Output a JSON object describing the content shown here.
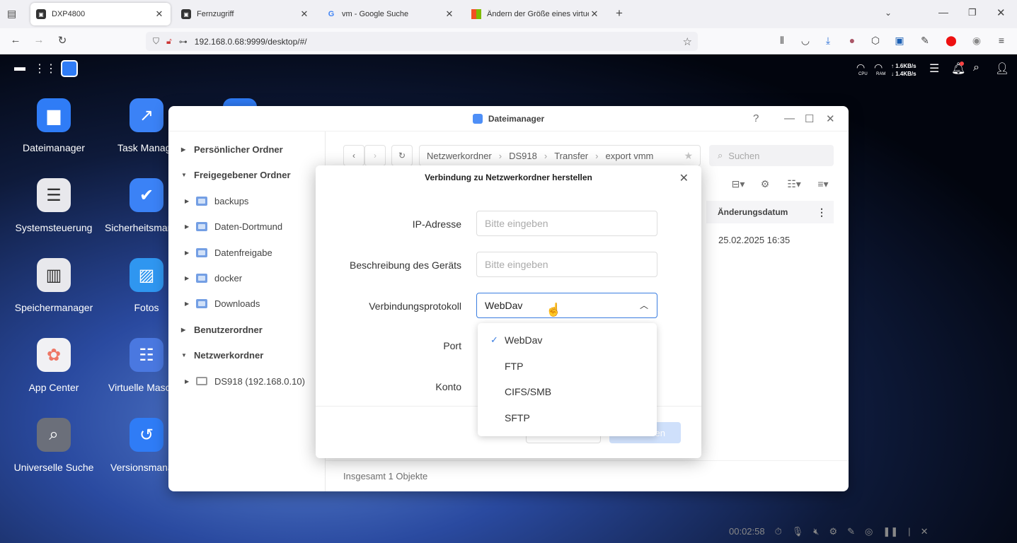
{
  "browser": {
    "tabs": [
      {
        "title": "DXP4800",
        "active": true
      },
      {
        "title": "Fernzugriff",
        "active": false
      },
      {
        "title": "vm - Google Suche",
        "active": false
      },
      {
        "title": "Ändern der Größe eines virtuellen",
        "active": false
      }
    ],
    "url": "192.168.0.68:9999/desktop/#/"
  },
  "nas_topbar": {
    "cpu_label": "CPU",
    "ram_label": "RAM",
    "up_rate": "↑ 1.6KB/s",
    "down_rate": "↓ 1.4KB/s"
  },
  "desktop_icons": [
    {
      "label": "Dateimanager",
      "icon": "folder-icon",
      "color": "#2f7cf6"
    },
    {
      "label": "Task Manag",
      "icon": "chart-icon",
      "color": "#3b82f6"
    },
    {
      "label": "Systemsteuerung",
      "icon": "sliders-icon",
      "color": "#e8e8ec"
    },
    {
      "label": "Sicherheitsman",
      "icon": "shield-icon",
      "color": "#3b82f6"
    },
    {
      "label": "Speichermanager",
      "icon": "drives-icon",
      "color": "#e8e8ec"
    },
    {
      "label": "Fotos",
      "icon": "photo-icon",
      "color": "#2f96f0"
    },
    {
      "label": "App Center",
      "icon": "apps-icon",
      "color": "#f1f1f4"
    },
    {
      "label": "Virtuelle Masc",
      "icon": "server-icon",
      "color": "#4a78e0"
    },
    {
      "label": "Universelle Suche",
      "icon": "search-db-icon",
      "color": "#6b6f7a"
    },
    {
      "label": "Versionsmana",
      "icon": "restore-icon",
      "color": "#2f7cf6"
    }
  ],
  "window": {
    "title": "Dateimanager",
    "sidebar": [
      {
        "label": "Persönlicher Ordner",
        "type": "header",
        "expanded": false
      },
      {
        "label": "Freigegebener Ordner",
        "type": "header",
        "expanded": true
      },
      {
        "label": "backups",
        "type": "folder"
      },
      {
        "label": "Daten-Dortmund",
        "type": "folder"
      },
      {
        "label": "Datenfreigabe",
        "type": "folder"
      },
      {
        "label": "docker",
        "type": "folder"
      },
      {
        "label": "Downloads",
        "type": "folder"
      },
      {
        "label": "Benutzerordner",
        "type": "header",
        "expanded": false
      },
      {
        "label": "Netzwerkordner",
        "type": "header",
        "expanded": true
      },
      {
        "label": "DS918 (192.168.0.10)",
        "type": "device"
      }
    ],
    "breadcrumb": [
      "Netzwerkordner",
      "DS918",
      "Transfer",
      "export vmm"
    ],
    "search_placeholder": "Suchen",
    "column_header": "Änderungsdatum",
    "row_date": "25.02.2025 16:35",
    "status": "Insgesamt 1 Objekte"
  },
  "dialog": {
    "title": "Verbindung zu Netzwerkordner herstellen",
    "fields": [
      {
        "label": "IP-Adresse",
        "placeholder": "Bitte eingeben"
      },
      {
        "label": "Beschreibung des Geräts",
        "placeholder": "Bitte eingeben"
      },
      {
        "label": "Verbindungsprotokoll",
        "value": "WebDav"
      },
      {
        "label": "Port"
      },
      {
        "label": "Konto"
      }
    ],
    "protocol_options": [
      {
        "label": "WebDav",
        "selected": true
      },
      {
        "label": "FTP",
        "selected": false
      },
      {
        "label": "CIFS/SMB",
        "selected": false
      },
      {
        "label": "SFTP",
        "selected": false
      }
    ],
    "primary_button_fragment": "en"
  },
  "bottom_bar": {
    "timer": "00:02:58"
  }
}
